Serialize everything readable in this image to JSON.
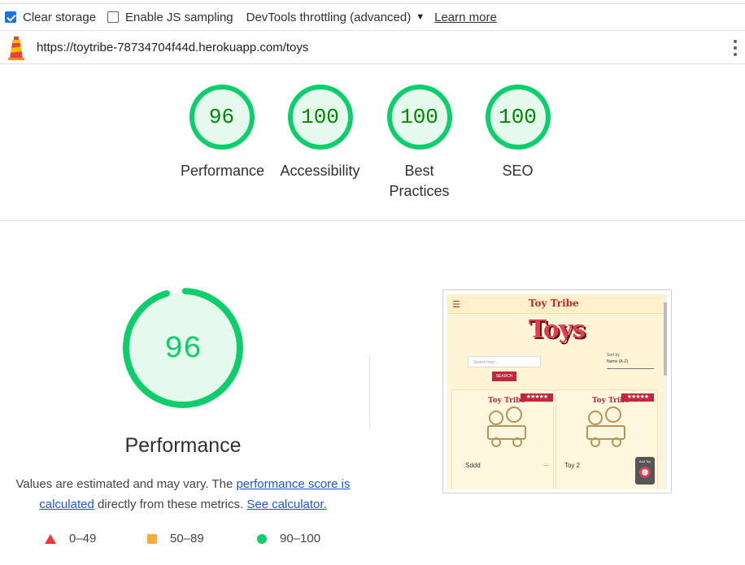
{
  "toolbar": {
    "clear_storage": {
      "label": "Clear storage",
      "checked": true
    },
    "js_sampling": {
      "label": "Enable JS sampling",
      "checked": false
    },
    "throttling": "DevTools throttling (advanced)",
    "learn_more": "Learn more"
  },
  "url": "https://toytribe-78734704f44d.herokuapp.com/toys",
  "gauges": [
    {
      "score": "96",
      "label": "Performance"
    },
    {
      "score": "100",
      "label": "Accessibility"
    },
    {
      "score": "100",
      "label": "Best Practices"
    },
    {
      "score": "100",
      "label": "SEO"
    }
  ],
  "performance": {
    "score": "96",
    "score_value": 96,
    "title": "Performance",
    "desc_1": "Values are estimated and may vary. The ",
    "desc_link_1": "performance score is calculated",
    "desc_2": " directly from these metrics. ",
    "desc_link_2": "See calculator."
  },
  "legend": [
    {
      "range": "0–49",
      "icon": "red-triangle-icon"
    },
    {
      "range": "50–89",
      "icon": "orange-square-icon"
    },
    {
      "range": "90–100",
      "icon": "green-circle-icon"
    }
  ],
  "thumbnail": {
    "brand": "Toy Tribe",
    "title": "Toys",
    "search_placeholder": "Search toys...",
    "search_button": "SEARCH",
    "sort_label": "Sort by",
    "sort_value": "Name (A-Z)",
    "card_brand": "Toy Tribe",
    "card_stars": "★★★★★",
    "cards": [
      {
        "name": "Sddd",
        "more": "..."
      },
      {
        "name": "Toy 2",
        "more": ""
      }
    ],
    "add_toy": "Add Toy"
  },
  "colors": {
    "pass_green": "#0cce6b",
    "pass_fill": "#e6f9ed",
    "pass_text": "#008800",
    "average_orange": "#ffaa33",
    "fail_red": "#ff3333",
    "link_blue": "#1a56db",
    "toy_red": "#c0273a"
  }
}
